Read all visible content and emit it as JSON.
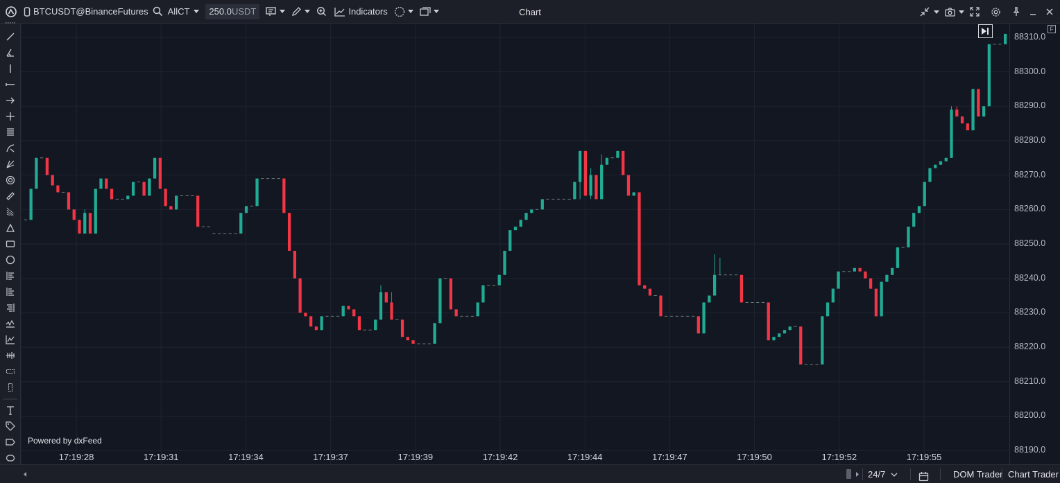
{
  "toolbar": {
    "symbol": "BTCUSDT@BinanceFutures",
    "account": "AllCT",
    "quantity": "250.0",
    "quantity_unit": "USDT",
    "indicators_label": "Indicators",
    "title": "Chart"
  },
  "chart_data": {
    "type": "candlestick",
    "y_ticks": [
      88310,
      88300,
      88290,
      88280,
      88270,
      88260,
      88250,
      88240,
      88230,
      88220,
      88210,
      88200,
      88190
    ],
    "x_ticks": [
      "17:19:28",
      "17:19:31",
      "17:19:34",
      "17:19:37",
      "17:19:39",
      "17:19:42",
      "17:19:44",
      "17:19:47",
      "17:19:50",
      "17:19:52",
      "17:19:55"
    ],
    "ylim": [
      88186,
      88314
    ],
    "up_color": "#22ab94",
    "down_color": "#f23645",
    "grid": true,
    "candles": [
      [
        88257,
        88257,
        88257,
        88257
      ],
      [
        88257,
        88266,
        88257,
        88266
      ],
      [
        88266,
        88275,
        88266,
        88275
      ],
      [
        88275,
        88275,
        88275,
        88275
      ],
      [
        88275,
        88270,
        88270,
        88275
      ],
      [
        88270,
        88267,
        88267,
        88270
      ],
      [
        88267,
        88265,
        88265,
        88267
      ],
      [
        88265,
        88265,
        88265,
        88265
      ],
      [
        88265,
        88260,
        88260,
        88265
      ],
      [
        88260,
        88257,
        88257,
        88260
      ],
      [
        88257,
        88253,
        88253,
        88257
      ],
      [
        88253,
        88259,
        88253,
        88260
      ],
      [
        88259,
        88253,
        88253,
        88259
      ],
      [
        88253,
        88266,
        88253,
        88266
      ],
      [
        88266,
        88269,
        88266,
        88269
      ],
      [
        88269,
        88266,
        88266,
        88269
      ],
      [
        88266,
        88263,
        88263,
        88266
      ],
      [
        88263,
        88263,
        88263,
        88263
      ],
      [
        88263,
        88263,
        88263,
        88263
      ],
      [
        88263,
        88264,
        88263,
        88264
      ],
      [
        88264,
        88268,
        88264,
        88268
      ],
      [
        88268,
        88268,
        88268,
        88268
      ],
      [
        88268,
        88264,
        88264,
        88268
      ],
      [
        88264,
        88269,
        88264,
        88269
      ],
      [
        88269,
        88275,
        88269,
        88275
      ],
      [
        88275,
        88266,
        88266,
        88275
      ],
      [
        88266,
        88261,
        88261,
        88266
      ],
      [
        88261,
        88260,
        88260,
        88261
      ],
      [
        88260,
        88264,
        88260,
        88264
      ],
      [
        88264,
        88264,
        88264,
        88264
      ],
      [
        88264,
        88264,
        88264,
        88264
      ],
      [
        88264,
        88264,
        88264,
        88264
      ],
      [
        88264,
        88255,
        88255,
        88264
      ],
      [
        88255,
        88255,
        88255,
        88255
      ],
      [
        88255,
        88255,
        88255,
        88255
      ],
      [
        88253,
        88253,
        88253,
        88253
      ],
      [
        88253,
        88253,
        88253,
        88253
      ],
      [
        88253,
        88253,
        88253,
        88253
      ],
      [
        88253,
        88253,
        88253,
        88253
      ],
      [
        88253,
        88253,
        88253,
        88253
      ],
      [
        88253,
        88259,
        88253,
        88259
      ],
      [
        88259,
        88261,
        88259,
        88261
      ],
      [
        88261,
        88261,
        88261,
        88261
      ],
      [
        88261,
        88269,
        88261,
        88269
      ],
      [
        88269,
        88269,
        88269,
        88269
      ],
      [
        88269,
        88269,
        88269,
        88269
      ],
      [
        88269,
        88269,
        88269,
        88269
      ],
      [
        88269,
        88269,
        88269,
        88269
      ],
      [
        88269,
        88259,
        88259,
        88269
      ],
      [
        88259,
        88248,
        88248,
        88259
      ],
      [
        88248,
        88240,
        88240,
        88248
      ],
      [
        88240,
        88230,
        88230,
        88240
      ],
      [
        88230,
        88229,
        88229,
        88230
      ],
      [
        88229,
        88226,
        88226,
        88229
      ],
      [
        88226,
        88225,
        88225,
        88226
      ],
      [
        88225,
        88229,
        88225,
        88229
      ],
      [
        88229,
        88229,
        88229,
        88229
      ],
      [
        88229,
        88229,
        88229,
        88229
      ],
      [
        88229,
        88229,
        88229,
        88229
      ],
      [
        88229,
        88232,
        88229,
        88232
      ],
      [
        88232,
        88231,
        88231,
        88232
      ],
      [
        88231,
        88229,
        88229,
        88231
      ],
      [
        88229,
        88225,
        88225,
        88229
      ],
      [
        88225,
        88225,
        88225,
        88225
      ],
      [
        88225,
        88225,
        88225,
        88225
      ],
      [
        88225,
        88228,
        88225,
        88228
      ],
      [
        88228,
        88236,
        88228,
        88238
      ],
      [
        88236,
        88233,
        88233,
        88236
      ],
      [
        88233,
        88228,
        88228,
        88236
      ],
      [
        88228,
        88228,
        88228,
        88228
      ],
      [
        88228,
        88223,
        88223,
        88228
      ],
      [
        88223,
        88222,
        88222,
        88223
      ],
      [
        88222,
        88221,
        88221,
        88222
      ],
      [
        88221,
        88221,
        88221,
        88221
      ],
      [
        88221,
        88221,
        88221,
        88221
      ],
      [
        88221,
        88221,
        88221,
        88221
      ],
      [
        88221,
        88227,
        88221,
        88227
      ],
      [
        88227,
        88240,
        88227,
        88240
      ],
      [
        88240,
        88240,
        88240,
        88240
      ],
      [
        88240,
        88231,
        88231,
        88240
      ],
      [
        88231,
        88229,
        88229,
        88231
      ],
      [
        88229,
        88229,
        88229,
        88229
      ],
      [
        88229,
        88229,
        88229,
        88229
      ],
      [
        88229,
        88229,
        88229,
        88229
      ],
      [
        88229,
        88233,
        88229,
        88233
      ],
      [
        88233,
        88238,
        88233,
        88238
      ],
      [
        88238,
        88238,
        88238,
        88238
      ],
      [
        88238,
        88238,
        88238,
        88238
      ],
      [
        88238,
        88241,
        88238,
        88241
      ],
      [
        88241,
        88248,
        88241,
        88248
      ],
      [
        88248,
        88254,
        88248,
        88254
      ],
      [
        88254,
        88255,
        88254,
        88255
      ],
      [
        88255,
        88257,
        88255,
        88257
      ],
      [
        88257,
        88259,
        88257,
        88259
      ],
      [
        88259,
        88260,
        88259,
        88260
      ],
      [
        88260,
        88260,
        88260,
        88260
      ],
      [
        88260,
        88263,
        88260,
        88263
      ],
      [
        88263,
        88263,
        88263,
        88263
      ],
      [
        88263,
        88263,
        88263,
        88263
      ],
      [
        88263,
        88263,
        88263,
        88263
      ],
      [
        88263,
        88263,
        88263,
        88263
      ],
      [
        88263,
        88263,
        88263,
        88263
      ],
      [
        88263,
        88268,
        88263,
        88268
      ],
      [
        88268,
        88277,
        88263,
        88277
      ],
      [
        88277,
        88264,
        88264,
        88277
      ],
      [
        88264,
        88270,
        88263,
        88272
      ],
      [
        88270,
        88263,
        88263,
        88270
      ],
      [
        88263,
        88273,
        88263,
        88276
      ],
      [
        88273,
        88275,
        88273,
        88275
      ],
      [
        88275,
        88275,
        88275,
        88275
      ],
      [
        88275,
        88277,
        88275,
        88277
      ],
      [
        88277,
        88270,
        88270,
        88277
      ],
      [
        88270,
        88264,
        88264,
        88270
      ],
      [
        88264,
        88265,
        88264,
        88265
      ],
      [
        88265,
        88238,
        88238,
        88265
      ],
      [
        88238,
        88237,
        88237,
        88238
      ],
      [
        88237,
        88235,
        88235,
        88237
      ],
      [
        88235,
        88235,
        88235,
        88235
      ],
      [
        88235,
        88229,
        88229,
        88235
      ],
      [
        88229,
        88229,
        88229,
        88229
      ],
      [
        88229,
        88229,
        88229,
        88229
      ],
      [
        88229,
        88229,
        88229,
        88229
      ],
      [
        88229,
        88229,
        88229,
        88229
      ],
      [
        88229,
        88229,
        88229,
        88229
      ],
      [
        88229,
        88229,
        88229,
        88229
      ],
      [
        88229,
        88224,
        88224,
        88229
      ],
      [
        88224,
        88233,
        88224,
        88233
      ],
      [
        88233,
        88235,
        88233,
        88235
      ],
      [
        88235,
        88241,
        88235,
        88247
      ],
      [
        88241,
        88241,
        88241,
        88246
      ],
      [
        88241,
        88241,
        88241,
        88241
      ],
      [
        88241,
        88241,
        88241,
        88241
      ],
      [
        88241,
        88241,
        88241,
        88241
      ],
      [
        88241,
        88233,
        88233,
        88241
      ],
      [
        88233,
        88233,
        88233,
        88233
      ],
      [
        88233,
        88233,
        88233,
        88233
      ],
      [
        88233,
        88233,
        88233,
        88233
      ],
      [
        88233,
        88233,
        88233,
        88233
      ],
      [
        88233,
        88222,
        88222,
        88233
      ],
      [
        88222,
        88223,
        88222,
        88223
      ],
      [
        88223,
        88224,
        88223,
        88224
      ],
      [
        88224,
        88225,
        88224,
        88225
      ],
      [
        88225,
        88226,
        88225,
        88226
      ],
      [
        88226,
        88226,
        88226,
        88226
      ],
      [
        88226,
        88215,
        88215,
        88226
      ],
      [
        88215,
        88215,
        88215,
        88215
      ],
      [
        88215,
        88215,
        88215,
        88215
      ],
      [
        88215,
        88215,
        88215,
        88215
      ],
      [
        88215,
        88229,
        88215,
        88229
      ],
      [
        88229,
        88233,
        88229,
        88233
      ],
      [
        88233,
        88237,
        88233,
        88237
      ],
      [
        88237,
        88242,
        88237,
        88242
      ],
      [
        88242,
        88242,
        88242,
        88242
      ],
      [
        88242,
        88242,
        88242,
        88242
      ],
      [
        88242,
        88243,
        88242,
        88243
      ],
      [
        88243,
        88242,
        88242,
        88243
      ],
      [
        88242,
        88240,
        88240,
        88242
      ],
      [
        88240,
        88237,
        88237,
        88240
      ],
      [
        88237,
        88229,
        88229,
        88237
      ],
      [
        88229,
        88239,
        88229,
        88239
      ],
      [
        88239,
        88241,
        88239,
        88241
      ],
      [
        88241,
        88243,
        88241,
        88243
      ],
      [
        88243,
        88249,
        88243,
        88249
      ],
      [
        88249,
        88249,
        88249,
        88249
      ],
      [
        88249,
        88255,
        88249,
        88255
      ],
      [
        88255,
        88259,
        88255,
        88259
      ],
      [
        88259,
        88261,
        88259,
        88261
      ],
      [
        88261,
        88268,
        88261,
        88268
      ],
      [
        88268,
        88272,
        88268,
        88272
      ],
      [
        88272,
        88273,
        88272,
        88273
      ],
      [
        88273,
        88274,
        88273,
        88274
      ],
      [
        88274,
        88275,
        88274,
        88275
      ],
      [
        88275,
        88289,
        88275,
        88290
      ],
      [
        88289,
        88287,
        88287,
        88290
      ],
      [
        88287,
        88285,
        88285,
        88287
      ],
      [
        88285,
        88283,
        88283,
        88285
      ],
      [
        88283,
        88295,
        88283,
        88295
      ],
      [
        88295,
        88287,
        88287,
        88295
      ],
      [
        88287,
        88290,
        88287,
        88290
      ],
      [
        88290,
        88308,
        88290,
        88308
      ],
      [
        88308,
        88308,
        88308,
        88308
      ],
      [
        88308,
        88308,
        88308,
        88308
      ],
      [
        88308,
        88311,
        88308,
        88311
      ]
    ]
  },
  "powered_by": "Powered by dxFeed",
  "bottom": {
    "session": "24/7",
    "dom_trader": "DOM Trader",
    "chart_trader": "Chart Trader"
  },
  "badge": "F"
}
